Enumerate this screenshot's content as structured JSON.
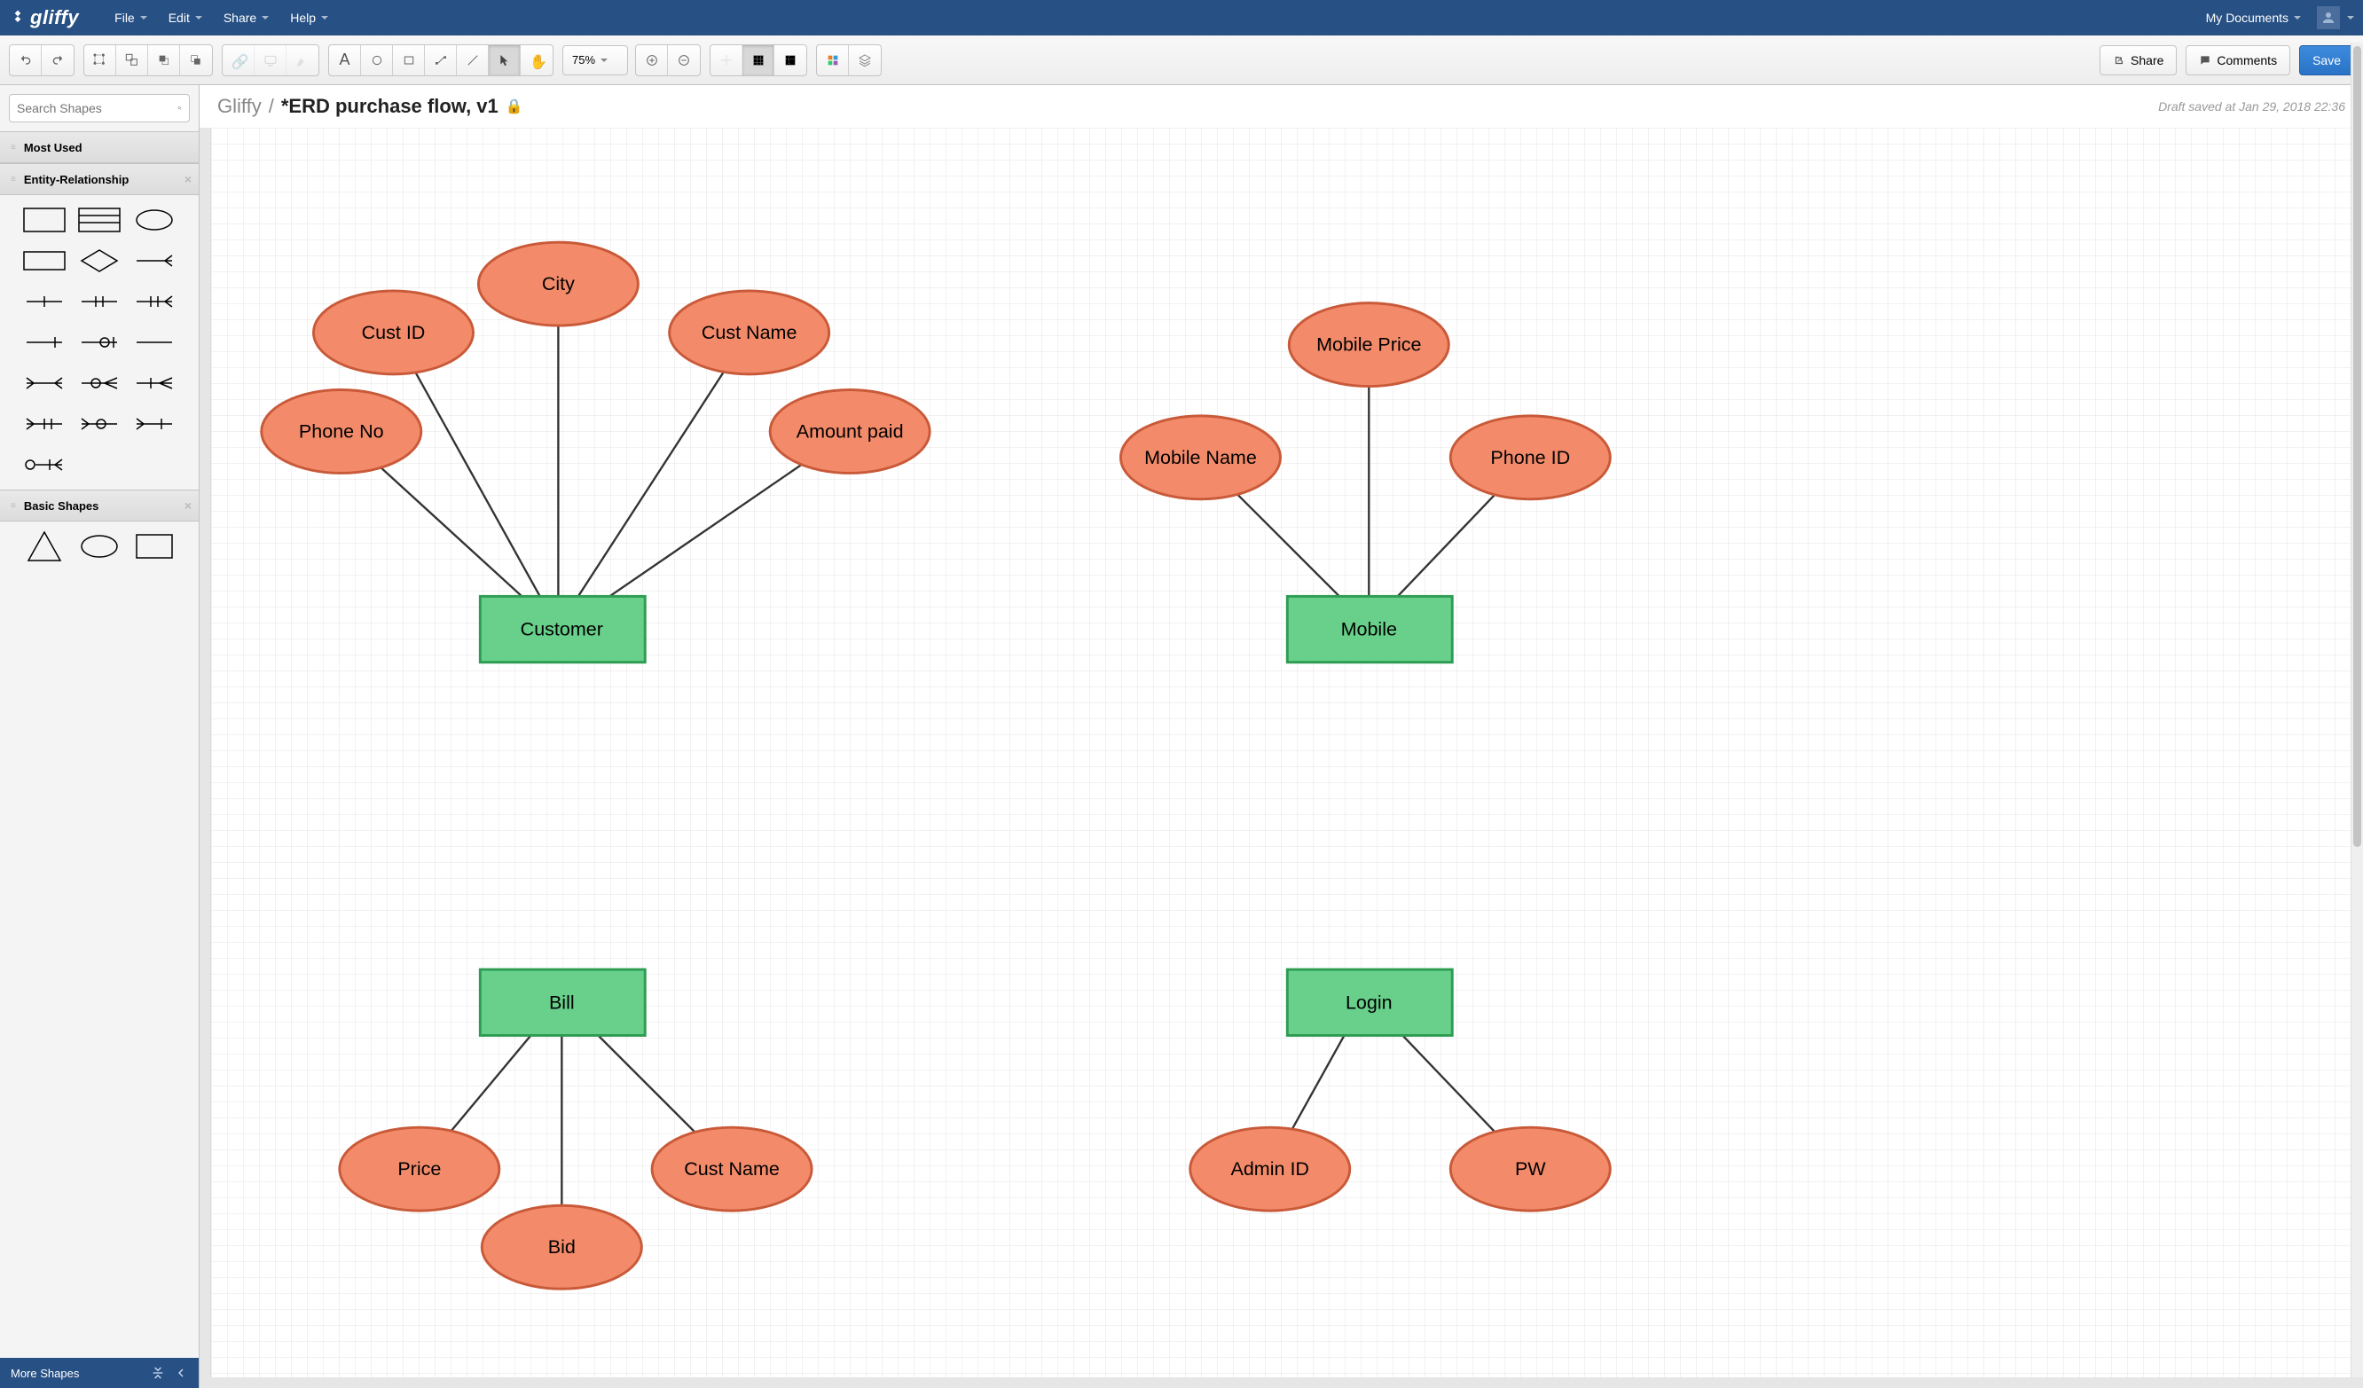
{
  "app": {
    "name": "gliffy"
  },
  "menubar": {
    "items": [
      "File",
      "Edit",
      "Share",
      "Help"
    ],
    "myDocs": "My Documents"
  },
  "toolbar": {
    "zoom": "75%",
    "share": "Share",
    "comments": "Comments",
    "save": "Save"
  },
  "sidebar": {
    "searchPlaceholder": "Search Shapes",
    "sections": {
      "mostUsed": "Most Used",
      "er": "Entity-Relationship",
      "basic": "Basic Shapes"
    },
    "moreShapes": "More Shapes"
  },
  "doc": {
    "bcRoot": "Gliffy",
    "bcSep": "/",
    "title": "*ERD purchase flow, v1",
    "status": "Draft saved at Jan 29, 2018 22:36"
  },
  "diagram": {
    "entities": {
      "customer": "Customer",
      "mobile": "Mobile",
      "bill": "Bill",
      "login": "Login"
    },
    "attrs": {
      "phoneNo": "Phone No",
      "custId": "Cust ID",
      "city": "City",
      "custName": "Cust Name",
      "amountPaid": "Amount paid",
      "mobileName": "Mobile Name",
      "mobilePrice": "Mobile Price",
      "phoneId": "Phone ID",
      "price": "Price",
      "bid": "Bid",
      "custName2": "Cust Name",
      "adminId": "Admin ID",
      "pw": "PW"
    }
  }
}
